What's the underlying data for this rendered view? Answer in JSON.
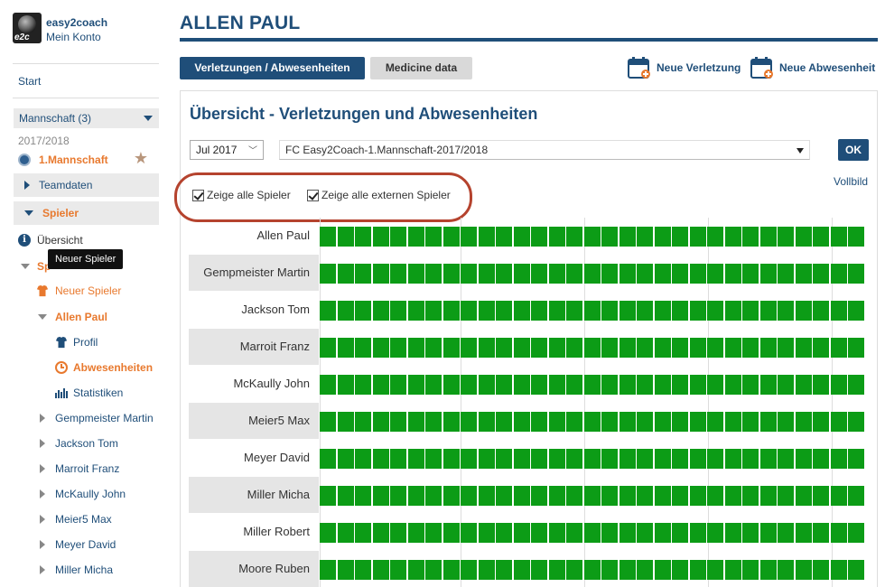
{
  "account": {
    "name": "easy2coach",
    "link": "Mein Konto",
    "logo_text": "e2c"
  },
  "sidebar": {
    "start": "Start",
    "team_select": "Mannschaft (3)",
    "season": "2017/2018",
    "team": "1.Mannschaft",
    "teamdaten": "Teamdaten",
    "spieler": "Spieler",
    "uebersicht": "Übersicht",
    "spieler_sub": "Sp",
    "tooltip": "Neuer Spieler",
    "neuer_spieler": "Neuer Spieler",
    "current_player": "Allen Paul",
    "player_items": [
      "Profil",
      "Abwesenheiten",
      "Statistiken"
    ],
    "other_players": [
      "Gempmeister Martin",
      "Jackson Tom",
      "Marroit Franz",
      "McKaully John",
      "Meier5 Max",
      "Meyer David",
      "Miller Micha"
    ]
  },
  "main": {
    "title": "ALLEN PAUL",
    "tabs": [
      "Verletzungen / Abwesenheiten",
      "Medicine data"
    ],
    "actions": [
      "Neue Verletzung",
      "Neue Abwesenheit"
    ],
    "panel_title": "Übersicht - Verletzungen und Abwesenheiten",
    "month": "Jul 2017",
    "team_option": "FC Easy2Coach-1.Mannschaft-2017/2018",
    "ok": "OK",
    "vollbild": "Vollbild",
    "checkboxes": [
      "Zeige alle Spieler",
      "Zeige alle externen Spieler"
    ],
    "players": [
      "Allen Paul",
      "Gempmeister Martin",
      "Jackson Tom",
      "Marroit Franz",
      "McKaully John",
      "Meier5 Max",
      "Meyer David",
      "Miller Micha",
      "Miller Robert",
      "Moore Ruben"
    ],
    "days_visible": 31,
    "present_color": "#0c9c16"
  },
  "colors": {
    "brand": "#1f4e79",
    "accent": "#e8792e",
    "highlight": "#b5432e"
  }
}
